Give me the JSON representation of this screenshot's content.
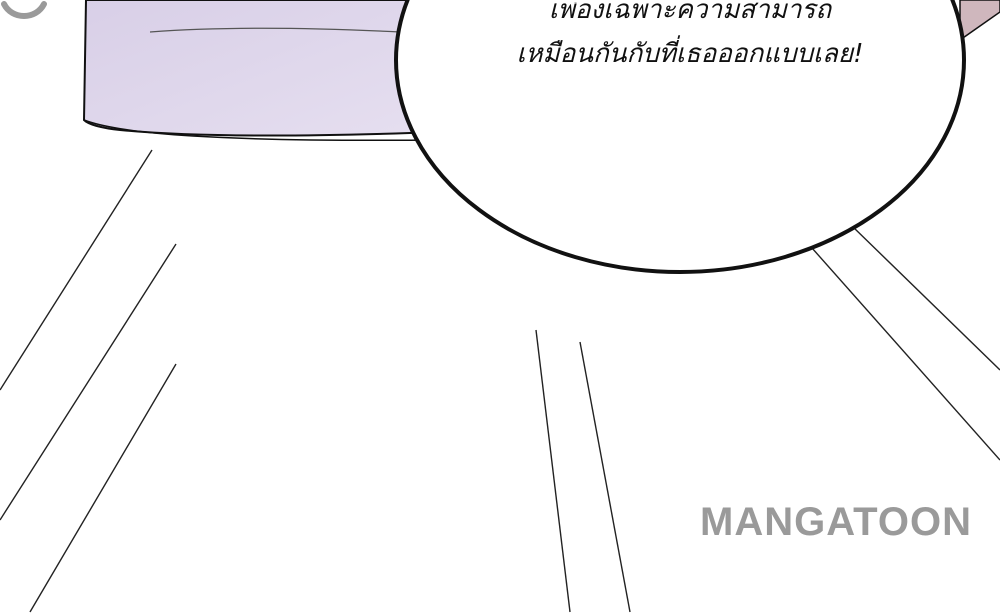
{
  "speech_bubble": {
    "line_1": "เพื่องเฉพาะความสามารถ",
    "line_2": "เหมือนกันกับที่เธอออกแบบเลย!"
  },
  "watermark": {
    "text": "MANGATOON",
    "smile_icon": "smile-icon"
  },
  "colors": {
    "background": "#ffffff",
    "pillow_fill": "#ddd5ea",
    "ink": "#111111",
    "watermark": "#9a9a9a"
  }
}
